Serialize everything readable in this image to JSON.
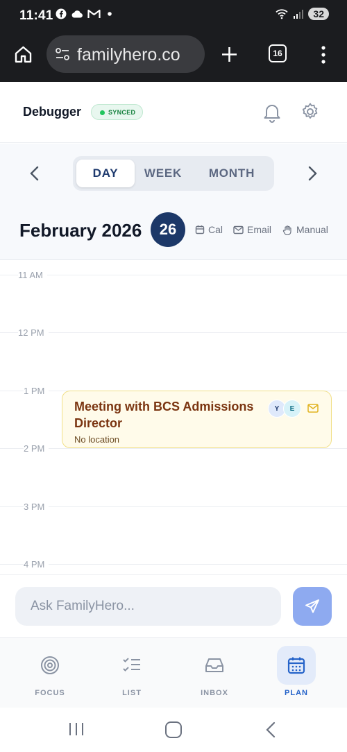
{
  "status_bar": {
    "time": "11:41",
    "battery": "32",
    "left_icons": [
      "facebook-icon",
      "cloud-icon",
      "gmail-icon",
      "dot-icon"
    ],
    "right_icons": [
      "wifi-icon",
      "signal-icon",
      "battery-icon"
    ]
  },
  "browser": {
    "url": "familyhero.co",
    "tab_count": "16"
  },
  "header": {
    "title": "Debugger",
    "sync_status": "SYNCED"
  },
  "view_toggle": {
    "options": [
      "DAY",
      "WEEK",
      "MONTH"
    ],
    "active": "DAY"
  },
  "date_header": {
    "month_year": "February 2026",
    "day": "26",
    "sources": [
      {
        "label": "Cal",
        "icon": "calendar-icon"
      },
      {
        "label": "Email",
        "icon": "mail-icon"
      },
      {
        "label": "Manual",
        "icon": "hand-icon"
      }
    ]
  },
  "timeline": {
    "hours": [
      "11 AM",
      "12 PM",
      "1 PM",
      "2 PM",
      "3 PM",
      "4 PM"
    ]
  },
  "event": {
    "title": "Meeting with BCS Admissions Director",
    "location": "No location",
    "attendees": [
      "Y",
      "E"
    ],
    "source_icon": "mail-icon"
  },
  "ask": {
    "placeholder": "Ask FamilyHero..."
  },
  "bottom_nav": {
    "items": [
      {
        "label": "FOCUS",
        "icon": "target-icon"
      },
      {
        "label": "LIST",
        "icon": "checklist-icon"
      },
      {
        "label": "INBOX",
        "icon": "inbox-icon"
      },
      {
        "label": "PLAN",
        "icon": "calendar-icon"
      }
    ],
    "active": "PLAN"
  },
  "colors": {
    "primary": "#1c3868",
    "accent": "#2563c9",
    "event_bg": "#fffbea",
    "event_border": "#f1df86",
    "event_title": "#7a3410",
    "synced_green": "#22c55e"
  }
}
